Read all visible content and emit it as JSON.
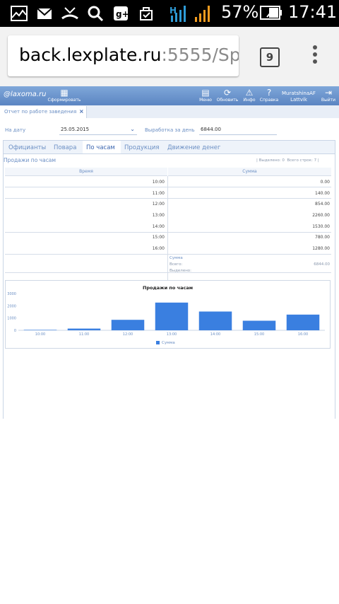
{
  "status_bar": {
    "icons": [
      "gallery-icon",
      "gmail-icon",
      "missed-call-icon",
      "search-icon",
      "google-plus-icon",
      "play-store-icon"
    ],
    "network_label": "H",
    "battery_percent": "57%",
    "time": "17:41"
  },
  "browser": {
    "url_host": "back.lexplate.ru",
    "url_rest": ":5555/Sp",
    "tab_count": "9"
  },
  "app_header": {
    "logo": "@laxoma.ru",
    "buttons": [
      {
        "label": "Сформировать",
        "icon": "calculator-icon"
      },
      {
        "label": "Меню",
        "icon": "menu-icon"
      },
      {
        "label": "Обновить",
        "icon": "refresh-icon"
      },
      {
        "label": "Инфо",
        "icon": "warning-icon"
      },
      {
        "label": "Справка",
        "icon": "help-icon"
      },
      {
        "label": "Выйти",
        "icon": "logout-icon"
      }
    ],
    "user_name": "MuratshinaAF",
    "user_sub": "Lattvik"
  },
  "page_tab": {
    "label": "Отчет по работе заведения",
    "close": "×"
  },
  "form": {
    "date_label": "На дату",
    "date_value": "25.05.2015",
    "output_label": "Выработка за день",
    "output_value": "6844.00"
  },
  "subtabs": [
    {
      "label": "Официанты",
      "active": false
    },
    {
      "label": "Повара",
      "active": false
    },
    {
      "label": "По часам",
      "active": true
    },
    {
      "label": "Продукция",
      "active": false
    },
    {
      "label": "Движение денег",
      "active": false
    }
  ],
  "grid": {
    "title": "Продажи по часам",
    "selected_info": "Выделено: 0",
    "total_rows_info": "Всего строк: 7",
    "columns": [
      "Время",
      "Сумма"
    ],
    "rows": [
      {
        "time": "10:00",
        "sum": "0.00"
      },
      {
        "time": "11:00",
        "sum": "140.00"
      },
      {
        "time": "12:00",
        "sum": "854.00"
      },
      {
        "time": "13:00",
        "sum": "2260.00"
      },
      {
        "time": "14:00",
        "sum": "1530.00"
      },
      {
        "time": "15:00",
        "sum": "780.00"
      },
      {
        "time": "16:00",
        "sum": "1280.00"
      }
    ],
    "footer": {
      "sum_label": "Сумма",
      "total_label": "Всего:",
      "total_value": "6844.00",
      "selected_label": "Выделено:"
    }
  },
  "chart_data": {
    "type": "bar",
    "title": "Продажи по часам",
    "categories": [
      "10:00",
      "11:00",
      "12:00",
      "13:00",
      "14:00",
      "15:00",
      "16:00"
    ],
    "series": [
      {
        "name": "Сумма",
        "values": [
          0,
          140,
          854,
          2260,
          1530,
          780,
          1280
        ]
      }
    ],
    "y_ticks": [
      "0",
      "1000",
      "2000",
      "3000"
    ],
    "ylim": [
      0,
      3000
    ],
    "xlabel": "",
    "ylabel": "",
    "legend_position": "bottom",
    "bar_color": "#3a7fe0"
  }
}
